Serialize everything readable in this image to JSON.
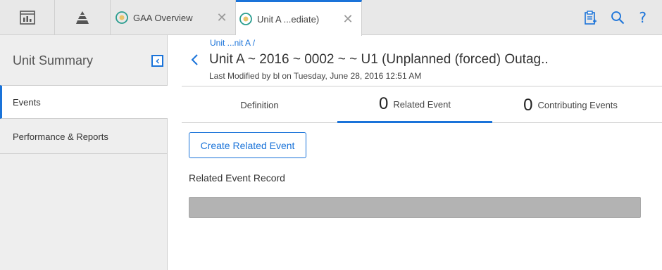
{
  "topbar": {
    "tabs": [
      {
        "label": "GAA Overview",
        "close": "✕"
      },
      {
        "label": "Unit A ...ediate)",
        "close": "✕"
      }
    ],
    "icons": [
      "dashboard-icon",
      "asset-hierarchy-icon",
      "report-icon",
      "search-icon",
      "help-icon"
    ],
    "help_glyph": "?"
  },
  "sidebar": {
    "title": "Unit Summary",
    "items": [
      {
        "label": "Events",
        "active": true
      },
      {
        "label": "Performance & Reports",
        "active": false
      }
    ]
  },
  "main": {
    "breadcrumb": "Unit ...nit A /",
    "title": "Unit A ~ 2016 ~ 0002 ~ ~ U1 (Unplanned (forced) Outag..",
    "subtitle": "Last Modified by bl on Tuesday, June 28, 2016 12:51 AM",
    "tabs": [
      {
        "count": "",
        "label": "Definition"
      },
      {
        "count": "0",
        "label": "Related Event"
      },
      {
        "count": "0",
        "label": "Contributing Events"
      }
    ],
    "create_button": "Create Related Event",
    "record_label": "Related Event Record"
  },
  "colors": {
    "accent": "#1a73d9",
    "sidebar_bg": "#eeeeee",
    "topbar_bg": "#e8e8e8"
  }
}
